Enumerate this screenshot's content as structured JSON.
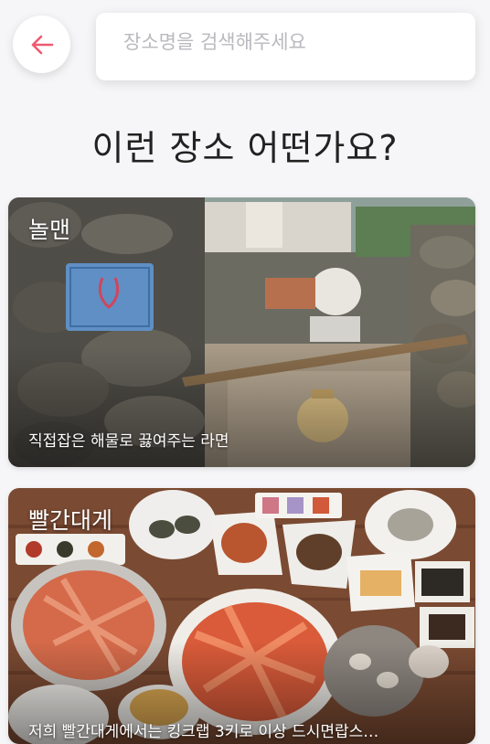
{
  "header": {
    "back_icon": "arrow-left-icon",
    "accent_color": "#ef5a6f"
  },
  "search": {
    "placeholder": "장소명을 검색해주세요",
    "value": ""
  },
  "heading": "이런 장소 어떤가요?",
  "places": [
    {
      "name": "놀맨",
      "description": "직접잡은 해물로 끓여주는 라면"
    },
    {
      "name": "빨간대게",
      "description": "저희 빨간대게에서는 킹크랩 3키로 이상 드시면랍스…"
    }
  ]
}
